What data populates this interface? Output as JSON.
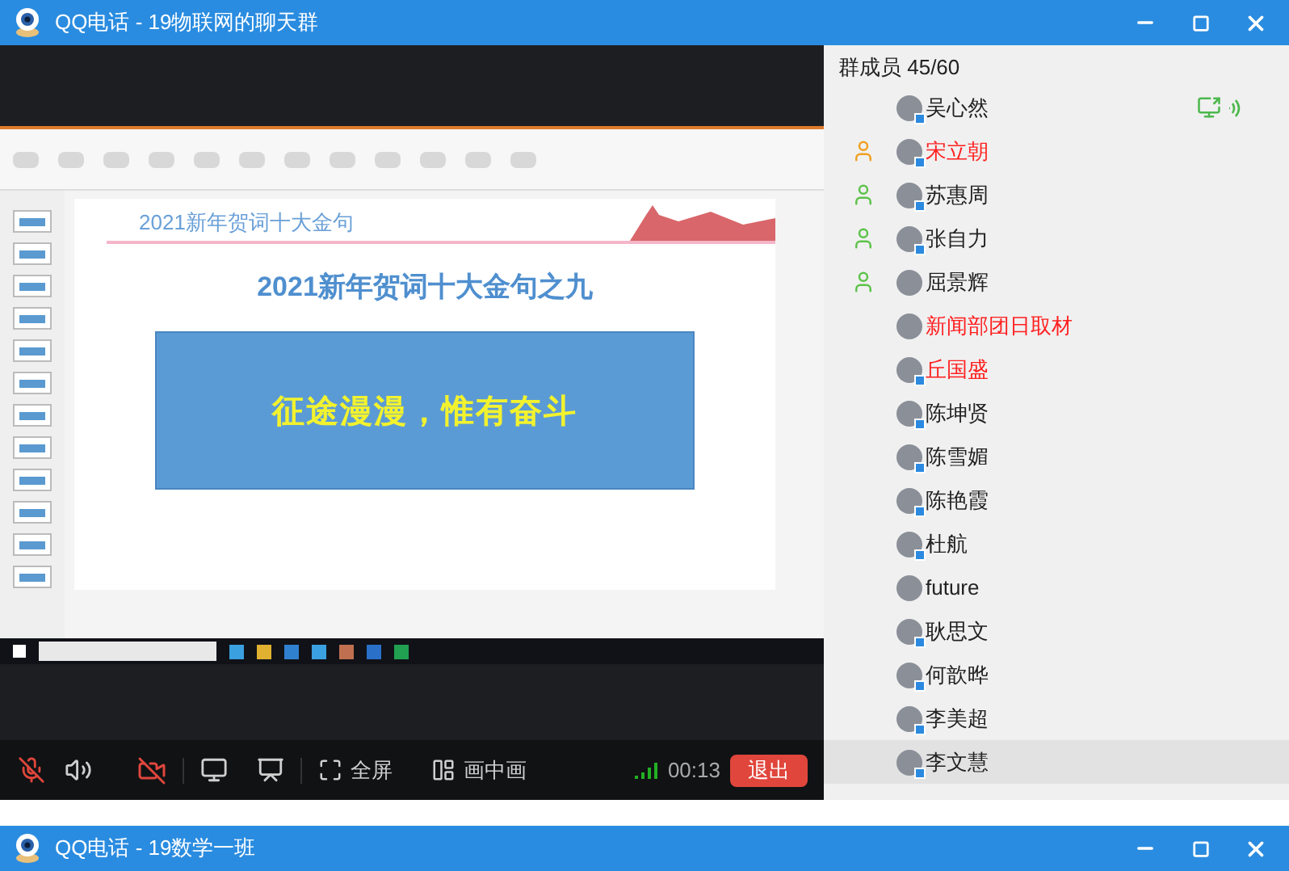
{
  "window": {
    "title": "QQ电话 - 19物联网的聊天群"
  },
  "shared_screen": {
    "slide_header": "2021新年贺词十大金句",
    "slide_title": "2021新年贺词十大金句之九",
    "slide_quote": "征途漫漫，惟有奋斗"
  },
  "members": {
    "header": "群成员 45/60",
    "items": [
      {
        "name": "吴心然",
        "highlighted": false,
        "kind": "member",
        "device_badge": true,
        "sharing": true,
        "selected": false
      },
      {
        "name": "宋立朝",
        "highlighted": true,
        "kind": "owner",
        "device_badge": true,
        "sharing": false,
        "selected": false
      },
      {
        "name": "苏惠周",
        "highlighted": false,
        "kind": "admin",
        "device_badge": true,
        "sharing": false,
        "selected": false
      },
      {
        "name": "张自力",
        "highlighted": false,
        "kind": "admin",
        "device_badge": true,
        "sharing": false,
        "selected": false
      },
      {
        "name": "屈景辉",
        "highlighted": false,
        "kind": "admin",
        "device_badge": false,
        "sharing": false,
        "selected": false
      },
      {
        "name": "新闻部团日取材",
        "highlighted": true,
        "kind": "member",
        "device_badge": false,
        "sharing": false,
        "selected": false
      },
      {
        "name": "丘国盛",
        "highlighted": true,
        "kind": "member",
        "device_badge": true,
        "sharing": false,
        "selected": false
      },
      {
        "name": "陈坤贤",
        "highlighted": false,
        "kind": "member",
        "device_badge": true,
        "sharing": false,
        "selected": false
      },
      {
        "name": "陈雪媚",
        "highlighted": false,
        "kind": "member",
        "device_badge": true,
        "sharing": false,
        "selected": false
      },
      {
        "name": "陈艳霞",
        "highlighted": false,
        "kind": "member",
        "device_badge": true,
        "sharing": false,
        "selected": false
      },
      {
        "name": "杜航",
        "highlighted": false,
        "kind": "member",
        "device_badge": true,
        "sharing": false,
        "selected": false
      },
      {
        "name": "future",
        "highlighted": false,
        "kind": "member",
        "device_badge": false,
        "sharing": false,
        "selected": false
      },
      {
        "name": "耿思文",
        "highlighted": false,
        "kind": "member",
        "device_badge": true,
        "sharing": false,
        "selected": false
      },
      {
        "name": "何歆晔",
        "highlighted": false,
        "kind": "member",
        "device_badge": true,
        "sharing": false,
        "selected": false
      },
      {
        "name": "李美超",
        "highlighted": false,
        "kind": "member",
        "device_badge": true,
        "sharing": false,
        "selected": false
      },
      {
        "name": "李文慧",
        "highlighted": false,
        "kind": "member",
        "device_badge": true,
        "sharing": false,
        "selected": true
      }
    ]
  },
  "controls": {
    "mic_muted": true,
    "camera_off": true,
    "fullscreen": "全屏",
    "pip": "画中画",
    "duration": "00:13",
    "exit": "退出"
  },
  "second_window": {
    "title": "QQ电话 - 19数学一班"
  }
}
